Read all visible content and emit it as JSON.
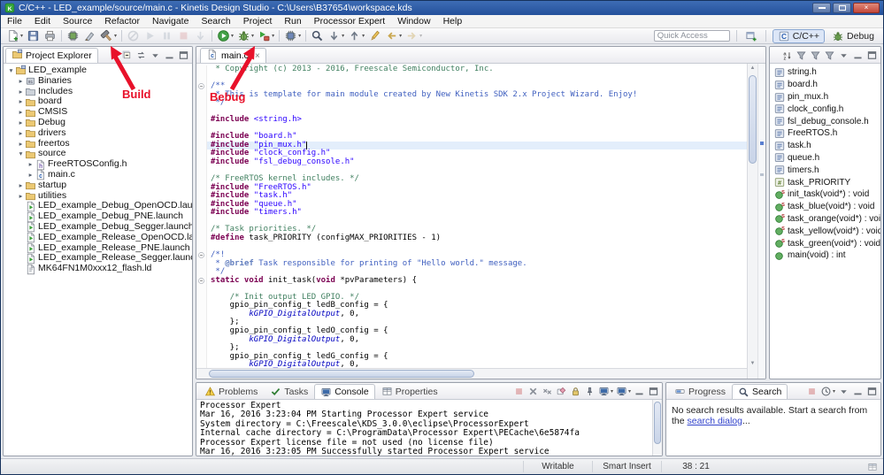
{
  "window": {
    "title": "C/C++ - LED_example/source/main.c - Kinetis Design Studio - C:\\Users\\B37654\\workspace.kds"
  },
  "menubar": [
    "File",
    "Edit",
    "Source",
    "Refactor",
    "Navigate",
    "Search",
    "Project",
    "Run",
    "Processor Expert",
    "Window",
    "Help"
  ],
  "toolbar": {
    "quick_access_placeholder": "Quick Access",
    "icons": [
      {
        "name": "new-wizard-icon",
        "shape": "pagenew",
        "dropdown": true
      },
      {
        "name": "save-icon",
        "shape": "floppy"
      },
      {
        "name": "print-icon",
        "shape": "printer"
      },
      {
        "sep": true
      },
      {
        "name": "processor-expert-icon",
        "shape": "chip",
        "color": "#76a65a"
      },
      {
        "name": "cutter-icon",
        "shape": "knife"
      },
      {
        "name": "build-icon",
        "shape": "hammer",
        "dropdown": true
      },
      {
        "sep": true
      },
      {
        "name": "skip-breakpoints-icon",
        "shape": "slashcircle",
        "color": "#9aa2ae",
        "disabled": true
      },
      {
        "name": "resume-icon",
        "shape": "play",
        "color": "#a8b2be",
        "disabled": true
      },
      {
        "name": "suspend-icon",
        "shape": "pause",
        "color": "#a8b2be",
        "disabled": true
      },
      {
        "name": "terminate-icon",
        "shape": "stop",
        "color": "#dba0a0",
        "disabled": true
      },
      {
        "name": "step-into-icon",
        "shape": "arrowD",
        "color": "#a8b2be",
        "disabled": true
      },
      {
        "sep": true
      },
      {
        "name": "run-icon",
        "shape": "playcircle",
        "color": "#43a047",
        "dropdown": true
      },
      {
        "name": "debug-icon",
        "shape": "bug",
        "dropdown": true
      },
      {
        "name": "external-tools-icon",
        "shape": "playbox",
        "dropdown": true
      },
      {
        "sep": true
      },
      {
        "name": "flash-programmer-icon",
        "shape": "chip",
        "color": "#6f87b8",
        "dropdown": true
      },
      {
        "sep": true
      },
      {
        "name": "search-icon",
        "shape": "magnifier",
        "color": "#4a5568"
      },
      {
        "name": "next-annotation-icon",
        "shape": "arrowD",
        "color": "#707a88",
        "dropdown": true
      },
      {
        "name": "previous-annotation-icon",
        "shape": "arrowU",
        "color": "#707a88",
        "dropdown": true
      },
      {
        "name": "last-edit-location-icon",
        "shape": "pencil"
      },
      {
        "name": "back-icon",
        "shape": "arrowL",
        "color": "#c9a64e",
        "dropdown": true
      },
      {
        "name": "forward-icon",
        "shape": "arrowR",
        "color": "#c9a64e",
        "dropdown": true,
        "disabled": true
      }
    ],
    "perspectives": {
      "items": [
        {
          "label": "C/C++",
          "active": true
        },
        {
          "label": "Debug",
          "active": false
        }
      ]
    }
  },
  "annotations": {
    "build": "Build",
    "debug": "Bebug",
    "color": "#e8112a"
  },
  "project_explorer": {
    "title": "Project Explorer",
    "toolbar_icons": [
      "collapse-all",
      "link-with-editor",
      "view-menu",
      "minimize",
      "maximize"
    ],
    "tree": [
      {
        "label": "LED_example",
        "depth": 0,
        "state": "expanded",
        "icon": "project"
      },
      {
        "label": "Binaries",
        "depth": 1,
        "state": "collapsed",
        "icon": "binaries"
      },
      {
        "label": "Includes",
        "depth": 1,
        "state": "collapsed",
        "icon": "includes"
      },
      {
        "label": "board",
        "depth": 1,
        "state": "collapsed",
        "icon": "folder"
      },
      {
        "label": "CMSIS",
        "depth": 1,
        "state": "collapsed",
        "icon": "folder"
      },
      {
        "label": "Debug",
        "depth": 1,
        "state": "collapsed",
        "icon": "folder"
      },
      {
        "label": "drivers",
        "depth": 1,
        "state": "collapsed",
        "icon": "folder"
      },
      {
        "label": "freertos",
        "depth": 1,
        "state": "collapsed",
        "icon": "folder"
      },
      {
        "label": "source",
        "depth": 1,
        "state": "expanded",
        "icon": "folder"
      },
      {
        "label": "FreeRTOSConfig.h",
        "depth": 2,
        "state": "collapsed",
        "icon": "hfile"
      },
      {
        "label": "main.c",
        "depth": 2,
        "state": "collapsed",
        "icon": "cfile"
      },
      {
        "label": "startup",
        "depth": 1,
        "state": "collapsed",
        "icon": "folder"
      },
      {
        "label": "utilities",
        "depth": 1,
        "state": "collapsed",
        "icon": "folder"
      },
      {
        "label": "LED_example_Debug_OpenOCD.launch",
        "depth": 1,
        "state": "none",
        "icon": "launch"
      },
      {
        "label": "LED_example_Debug_PNE.launch",
        "depth": 1,
        "state": "none",
        "icon": "launch"
      },
      {
        "label": "LED_example_Debug_Segger.launch",
        "depth": 1,
        "state": "none",
        "icon": "launch"
      },
      {
        "label": "LED_example_Release_OpenOCD.launch",
        "depth": 1,
        "state": "none",
        "icon": "launch"
      },
      {
        "label": "LED_example_Release_PNE.launch",
        "depth": 1,
        "state": "none",
        "icon": "launch"
      },
      {
        "label": "LED_example_Release_Segger.launch",
        "depth": 1,
        "state": "none",
        "icon": "launch"
      },
      {
        "label": "MK64FN1M0xxx12_flash.ld",
        "depth": 1,
        "state": "none",
        "icon": "ld"
      }
    ]
  },
  "editor": {
    "tab": {
      "label": "main.c",
      "close": "×"
    },
    "code": [
      {
        "s": [
          [
            " * Copyright (c) 2013 - 2016, Freescale Semiconductor, Inc.",
            "c"
          ]
        ]
      },
      {
        "s": []
      },
      {
        "s": [
          [
            "/**",
            "d"
          ]
        ],
        "f": 1
      },
      {
        "s": [
          [
            " * This is template for main module created by New Kinetis SDK 2.x Project Wizard. Enjoy!",
            "d"
          ]
        ]
      },
      {
        "s": [
          [
            " */",
            "d"
          ]
        ]
      },
      {
        "s": []
      },
      {
        "s": [
          [
            "#include",
            "pp"
          ],
          [
            " ",
            "p"
          ],
          [
            "<string.h>",
            "s"
          ]
        ]
      },
      {
        "s": []
      },
      {
        "s": [
          [
            "#include",
            "pp"
          ],
          [
            " ",
            "p"
          ],
          [
            "\"board.h\"",
            "s"
          ]
        ]
      },
      {
        "s": [
          [
            "#include",
            "pp"
          ],
          [
            " ",
            "p"
          ],
          [
            "\"pin_mux.h\"",
            "s"
          ]
        ],
        "cur": 1
      },
      {
        "s": [
          [
            "#include",
            "pp"
          ],
          [
            " ",
            "p"
          ],
          [
            "\"clock_config.h\"",
            "s"
          ]
        ]
      },
      {
        "s": [
          [
            "#include",
            "pp"
          ],
          [
            " ",
            "p"
          ],
          [
            "\"fsl_debug_console.h\"",
            "s"
          ]
        ]
      },
      {
        "s": []
      },
      {
        "s": [
          [
            "/* FreeRTOS kernel includes. */",
            "c"
          ]
        ]
      },
      {
        "s": [
          [
            "#include",
            "pp"
          ],
          [
            " ",
            "p"
          ],
          [
            "\"FreeRTOS.h\"",
            "s"
          ]
        ]
      },
      {
        "s": [
          [
            "#include",
            "pp"
          ],
          [
            " ",
            "p"
          ],
          [
            "\"task.h\"",
            "s"
          ]
        ]
      },
      {
        "s": [
          [
            "#include",
            "pp"
          ],
          [
            " ",
            "p"
          ],
          [
            "\"queue.h\"",
            "s"
          ]
        ]
      },
      {
        "s": [
          [
            "#include",
            "pp"
          ],
          [
            " ",
            "p"
          ],
          [
            "\"timers.h\"",
            "s"
          ]
        ]
      },
      {
        "s": []
      },
      {
        "s": [
          [
            "/* Task priorities. */",
            "c"
          ]
        ]
      },
      {
        "s": [
          [
            "#define",
            "pp"
          ],
          [
            " task_PRIORITY (configMAX_PRIORITIES - 1)",
            "p"
          ]
        ]
      },
      {
        "s": []
      },
      {
        "s": [
          [
            "/*!",
            "d"
          ]
        ],
        "f": 1
      },
      {
        "s": [
          [
            " * ",
            "d"
          ],
          [
            "@brief",
            "dt"
          ],
          [
            " Task responsible for printing of \"Hello world.\" message.",
            "d"
          ]
        ]
      },
      {
        "s": [
          [
            " */",
            "d"
          ]
        ]
      },
      {
        "s": [
          [
            "static void",
            "k"
          ],
          [
            " init_task(",
            "p"
          ],
          [
            "void",
            "k"
          ],
          [
            " *pvParameters) {",
            "p"
          ]
        ],
        "f": 1
      },
      {
        "s": []
      },
      {
        "s": [
          [
            "    ",
            "p"
          ],
          [
            "/* Init output LED GPIO. */",
            "c"
          ]
        ]
      },
      {
        "s": [
          [
            "    gpio_pin_config_t ledB_config = {",
            "p"
          ]
        ]
      },
      {
        "s": [
          [
            "        ",
            "p"
          ],
          [
            "kGPIO_DigitalOutput",
            "e"
          ],
          [
            ", 0,",
            "p"
          ]
        ]
      },
      {
        "s": [
          [
            "    };",
            "p"
          ]
        ]
      },
      {
        "s": [
          [
            "    gpio_pin_config_t ledO_config = {",
            "p"
          ]
        ]
      },
      {
        "s": [
          [
            "        ",
            "p"
          ],
          [
            "kGPIO_DigitalOutput",
            "e"
          ],
          [
            ", 0,",
            "p"
          ]
        ]
      },
      {
        "s": [
          [
            "    };",
            "p"
          ]
        ]
      },
      {
        "s": [
          [
            "    gpio_pin_config_t ledG_config = {",
            "p"
          ]
        ]
      },
      {
        "s": [
          [
            "        ",
            "p"
          ],
          [
            "kGPIO_DigitalOutput",
            "e"
          ],
          [
            ", 0,",
            "p"
          ]
        ]
      },
      {
        "s": [
          [
            "    };",
            "p"
          ]
        ]
      }
    ]
  },
  "outline": {
    "toolbar_icons": [
      "sort",
      "hide-fields",
      "hide-static",
      "hide-non-public",
      "view-menu",
      "minimize",
      "maximize"
    ],
    "items": [
      {
        "label": "string.h",
        "icon": "include"
      },
      {
        "label": "board.h",
        "icon": "include"
      },
      {
        "label": "pin_mux.h",
        "icon": "include"
      },
      {
        "label": "clock_config.h",
        "icon": "include"
      },
      {
        "label": "fsl_debug_console.h",
        "icon": "include"
      },
      {
        "label": "FreeRTOS.h",
        "icon": "include"
      },
      {
        "label": "task.h",
        "icon": "include"
      },
      {
        "label": "queue.h",
        "icon": "include"
      },
      {
        "label": "timers.h",
        "icon": "include"
      },
      {
        "label": "task_PRIORITY",
        "icon": "define"
      },
      {
        "label": "init_task(void*) : void",
        "icon": "func-static"
      },
      {
        "label": "task_blue(void*) : void",
        "icon": "func-static"
      },
      {
        "label": "task_orange(void*) : void",
        "icon": "func-static"
      },
      {
        "label": "task_yellow(void*) : void",
        "icon": "func-static"
      },
      {
        "label": "task_green(void*) : void",
        "icon": "func-static"
      },
      {
        "label": "main(void) : int",
        "icon": "func"
      }
    ]
  },
  "console": {
    "tabs": [
      {
        "label": "Problems",
        "icon": "problems",
        "active": false
      },
      {
        "label": "Tasks",
        "icon": "tasks",
        "active": false
      },
      {
        "label": "Console",
        "icon": "console",
        "active": true
      },
      {
        "label": "Properties",
        "icon": "properties",
        "active": false
      }
    ],
    "toolbar_icons": [
      "terminate",
      "remove-launch",
      "remove-all-launches",
      "clear-console",
      "scroll-lock",
      "pin-console",
      "display-selected-console",
      "open-console",
      "minimize",
      "maximize"
    ],
    "title_line": "Processor Expert",
    "lines": [
      "Mar 16, 2016 3:23:04 PM Starting Processor Expert service",
      "System directory = C:\\Freescale\\KDS_3.0.0\\eclipse\\ProcessorExpert",
      "Internal cache directory = C:\\ProgramData\\Processor Expert\\PECache\\6e5874fa",
      "Processor Expert license file = not used (no license file)",
      "Mar 16, 2016 3:23:05 PM Successfully started Processor Expert service"
    ]
  },
  "search_view": {
    "tabs": [
      {
        "label": "Progress",
        "icon": "progress",
        "active": false
      },
      {
        "label": "Search",
        "icon": "search",
        "active": true
      }
    ],
    "toolbar_icons": [
      "cancel",
      "history",
      "view-menu",
      "minimize",
      "maximize"
    ],
    "message_pre": "No search results available. Start a search from the ",
    "message_link": "search dialog",
    "message_post": "..."
  },
  "statusbar": {
    "writable": "Writable",
    "insert_mode": "Smart Insert",
    "cursor_position": "38 : 21"
  }
}
